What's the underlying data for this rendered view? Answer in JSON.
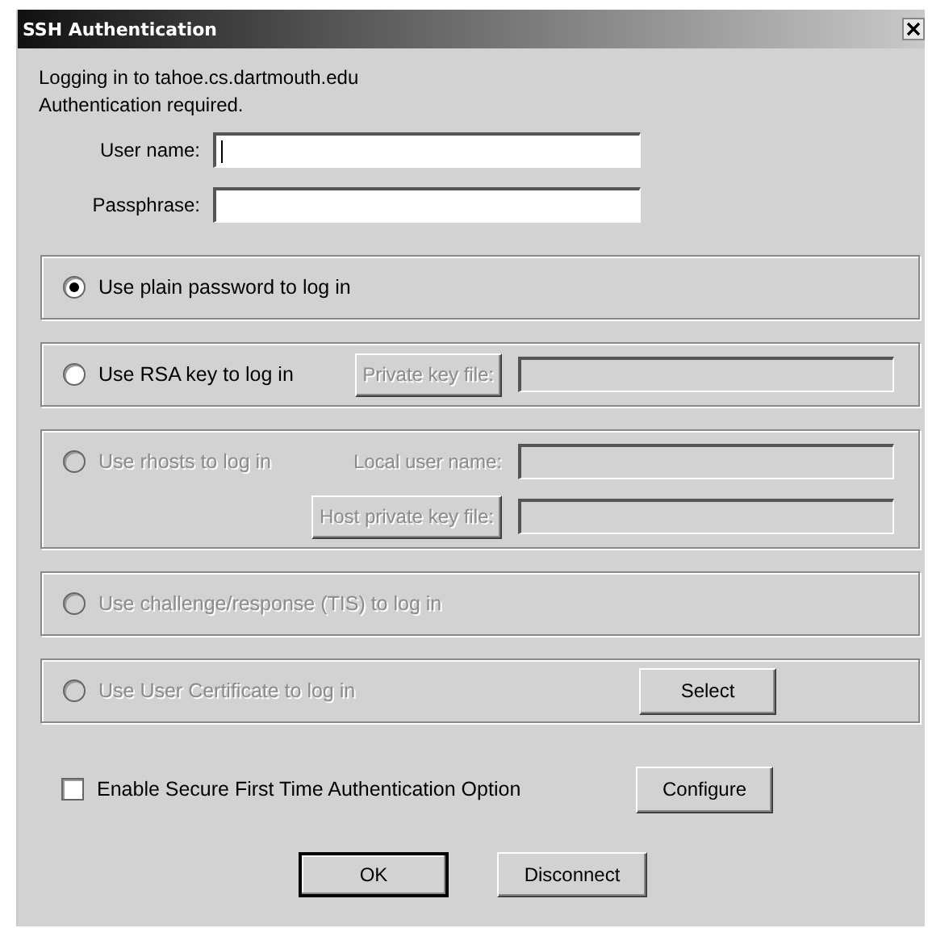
{
  "window": {
    "title": "SSH Authentication"
  },
  "intro": [
    "Logging in to tahoe.cs.dartmouth.edu",
    "Authentication required."
  ],
  "fields": [
    {
      "label": "User name:",
      "focused": true
    },
    {
      "label": "Passphrase:",
      "focused": false
    }
  ],
  "options": [
    {
      "label": "Use plain password to log in",
      "selected": true,
      "disabled": false
    },
    {
      "label": "Use RSA key to log in",
      "selected": false,
      "disabled": false,
      "rows": [
        {
          "control": {
            "kind": "button",
            "text": "Private key file:",
            "disabled": true
          },
          "field": {
            "disabled": true
          }
        }
      ]
    },
    {
      "label": "Use rhosts to log in",
      "selected": false,
      "disabled": true,
      "rows": [
        {
          "control": {
            "kind": "label",
            "text": "Local user name:",
            "disabled": true
          },
          "field": {
            "disabled": true
          }
        },
        {
          "control": {
            "kind": "button",
            "text": "Host private key file:",
            "disabled": true
          },
          "field": {
            "disabled": true
          }
        }
      ]
    },
    {
      "label": "Use challenge/response (TIS) to log in",
      "selected": false,
      "disabled": true
    },
    {
      "label": "Use User Certificate to log in",
      "selected": false,
      "disabled": true,
      "rows": [
        {
          "control": {
            "kind": "button",
            "text": "Select",
            "disabled": false
          }
        }
      ]
    }
  ],
  "checkbox": {
    "label": "Enable Secure First Time Authentication Option",
    "checked": false,
    "button": "Configure"
  },
  "buttons": [
    {
      "label": "OK",
      "default": true
    },
    {
      "label": "Disconnect",
      "default": false
    }
  ]
}
